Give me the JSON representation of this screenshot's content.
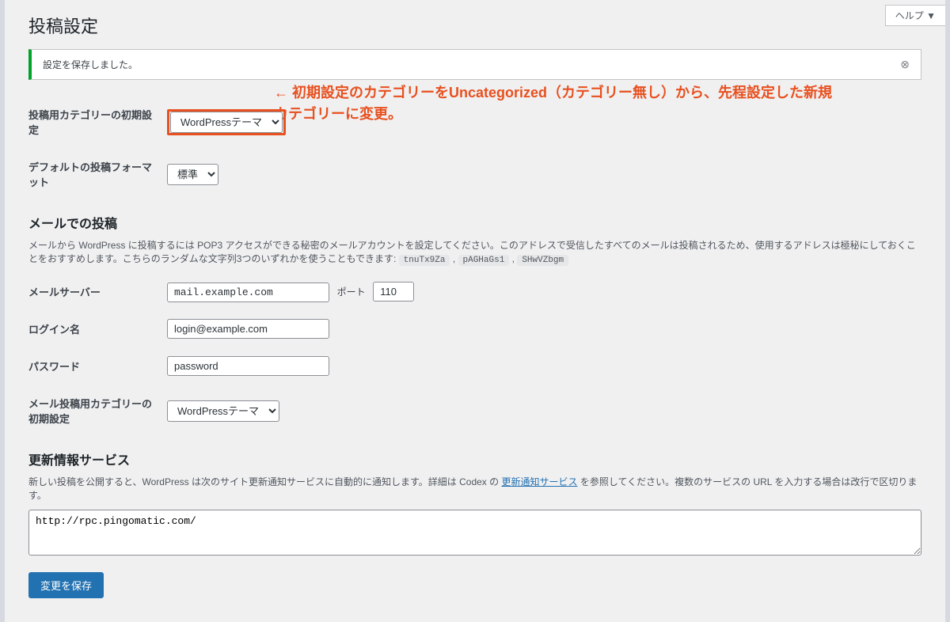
{
  "page": {
    "title": "投稿設定"
  },
  "help": {
    "label": "ヘルプ ▼"
  },
  "notice": {
    "text": "設定を保存しました。"
  },
  "fields": {
    "default_category_label": "投稿用カテゴリーの初期設定",
    "default_category_value": "WordPressテーマ",
    "default_format_label": "デフォルトの投稿フォーマット",
    "default_format_value": "標準"
  },
  "annotation": "← 初期設定のカテゴリーをUncategorized（カテゴリー無し）から、先程設定した新規カテゴリーに変更。",
  "mail_section": {
    "title": "メールでの投稿",
    "desc_prefix": "メールから WordPress に投稿するには POP3 アクセスができる秘密のメールアカウントを設定してください。このアドレスで受信したすべてのメールは投稿されるため、使用するアドレスは極秘にしておくことをおすすめします。こちらのランダムな文字列3つのいずれかを使うこともできます: ",
    "codes": [
      "tnuTx9Za",
      "pAGHaGs1",
      "SHwVZbgm"
    ],
    "server_label": "メールサーバー",
    "server_value": "mail.example.com",
    "port_label": "ポート",
    "port_value": "110",
    "login_label": "ログイン名",
    "login_value": "login@example.com",
    "password_label": "パスワード",
    "password_value": "password",
    "mail_category_label": "メール投稿用カテゴリーの初期設定",
    "mail_category_value": "WordPressテーマ"
  },
  "update_section": {
    "title": "更新情報サービス",
    "desc_before": "新しい投稿を公開すると、WordPress は次のサイト更新通知サービスに自動的に通知します。詳細は Codex の ",
    "link": "更新通知サービス",
    "desc_after": " を参照してください。複数のサービスの URL を入力する場合は改行で区切ります。",
    "textarea_value": "http://rpc.pingomatic.com/"
  },
  "submit": {
    "label": "変更を保存"
  }
}
